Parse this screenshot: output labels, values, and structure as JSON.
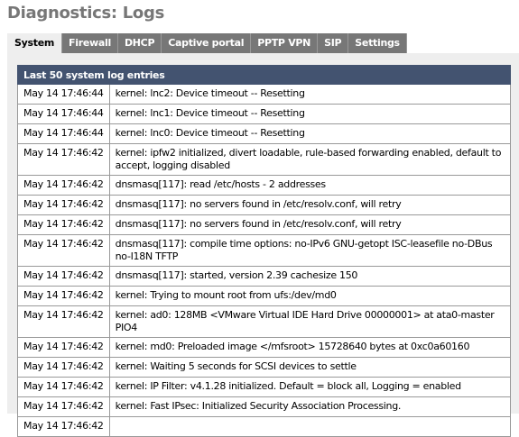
{
  "title": "Diagnostics: Logs",
  "tabs": [
    "System",
    "Firewall",
    "DHCP",
    "Captive portal",
    "PPTP VPN",
    "SIP",
    "Settings"
  ],
  "active_tab": "System",
  "table": {
    "header": "Last 50 system log entries",
    "rows": [
      [
        "May 14 17:46:44",
        "kernel: lnc2: Device timeout -- Resetting"
      ],
      [
        "May 14 17:46:44",
        "kernel: lnc1: Device timeout -- Resetting"
      ],
      [
        "May 14 17:46:44",
        "kernel: lnc0: Device timeout -- Resetting"
      ],
      [
        "May 14 17:46:42",
        "kernel: ipfw2 initialized, divert loadable, rule-based forwarding enabled, default to accept, logging disabled"
      ],
      [
        "May 14 17:46:42",
        "dnsmasq[117]: read /etc/hosts - 2 addresses"
      ],
      [
        "May 14 17:46:42",
        "dnsmasq[117]: no servers found in /etc/resolv.conf, will retry"
      ],
      [
        "May 14 17:46:42",
        "dnsmasq[117]: no servers found in /etc/resolv.conf, will retry"
      ],
      [
        "May 14 17:46:42",
        "dnsmasq[117]: compile time options: no-IPv6 GNU-getopt ISC-leasefile no-DBus no-I18N TFTP"
      ],
      [
        "May 14 17:46:42",
        "dnsmasq[117]: started, version 2.39 cachesize 150"
      ],
      [
        "May 14 17:46:42",
        "kernel: Trying to mount root from ufs:/dev/md0"
      ],
      [
        "May 14 17:46:42",
        "kernel: ad0: 128MB <VMware Virtual IDE Hard Drive 00000001> at ata0-master PIO4"
      ],
      [
        "May 14 17:46:42",
        "kernel: md0: Preloaded image </mfsroot> 15728640 bytes at 0xc0a60160"
      ],
      [
        "May 14 17:46:42",
        "kernel: Waiting 5 seconds for SCSI devices to settle"
      ],
      [
        "May 14 17:46:42",
        "kernel: IP Filter: v4.1.28 initialized. Default = block all, Logging = enabled"
      ],
      [
        "May 14 17:46:42",
        "kernel: Fast IPsec: Initialized Security Association Processing."
      ],
      [
        "May 14 17:46:42",
        ""
      ]
    ]
  }
}
